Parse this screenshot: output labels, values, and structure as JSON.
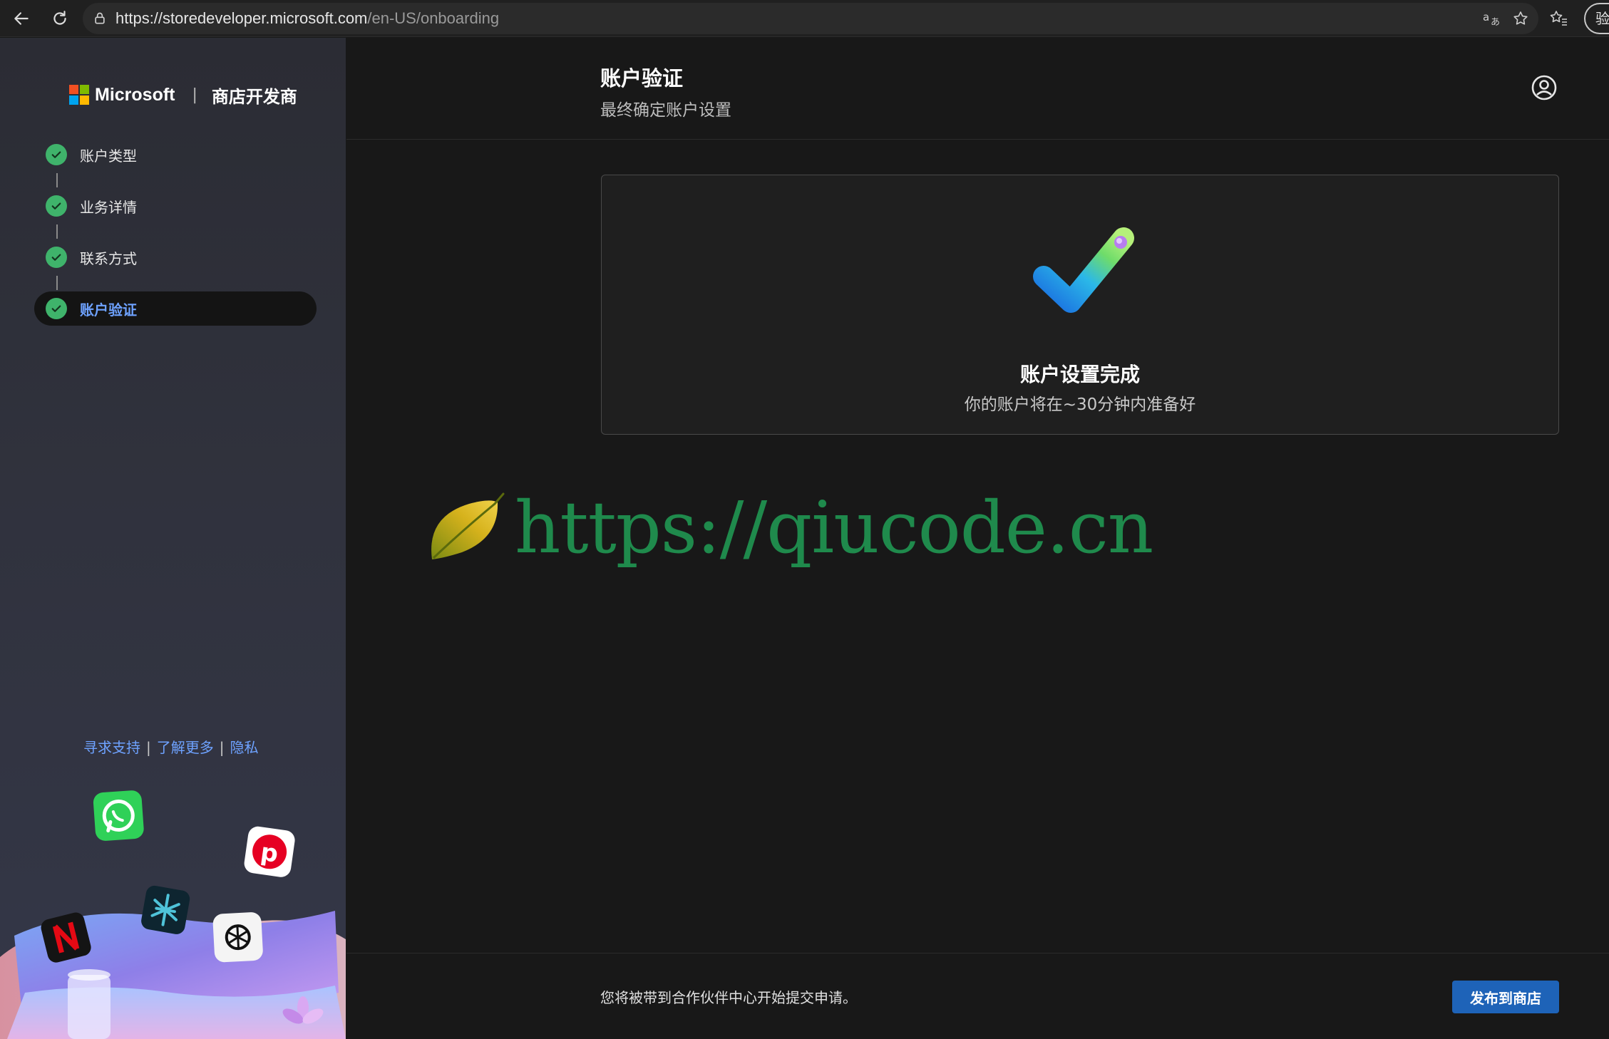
{
  "browser": {
    "url_host": "https://storedeveloper.microsoft.com",
    "url_path": "/en-US/onboarding",
    "profile_label": "验证",
    "icons": [
      "back-icon",
      "refresh-icon",
      "lock-icon",
      "translate-icon",
      "star-icon",
      "favorites-icon"
    ]
  },
  "sidebar": {
    "brand_name": "Microsoft",
    "brand_separator": "|",
    "product_name": "商店开发商",
    "steps": [
      {
        "label": "账户类型",
        "status": "complete"
      },
      {
        "label": "业务详情",
        "status": "complete"
      },
      {
        "label": "联系方式",
        "status": "complete"
      },
      {
        "label": "账户验证",
        "status": "complete",
        "active": true
      }
    ],
    "footer_links": {
      "support": "寻求支持",
      "learn_more": "了解更多",
      "privacy": "隐私",
      "separator": "|"
    },
    "colors": {
      "check": "#3fb36b",
      "link": "#6ea2ff"
    }
  },
  "header": {
    "title": "账户验证",
    "subtitle": "最终确定账户设置"
  },
  "card": {
    "title": "账户设置完成",
    "subtitle": "你的账户将在~30分钟内准备好"
  },
  "watermark": {
    "text": "https://qiucode.cn"
  },
  "footer": {
    "message": "您将被带到合作伙伴中心开始提交申请。",
    "publish_label": "发布到商店",
    "accent": "#1e63b8"
  }
}
